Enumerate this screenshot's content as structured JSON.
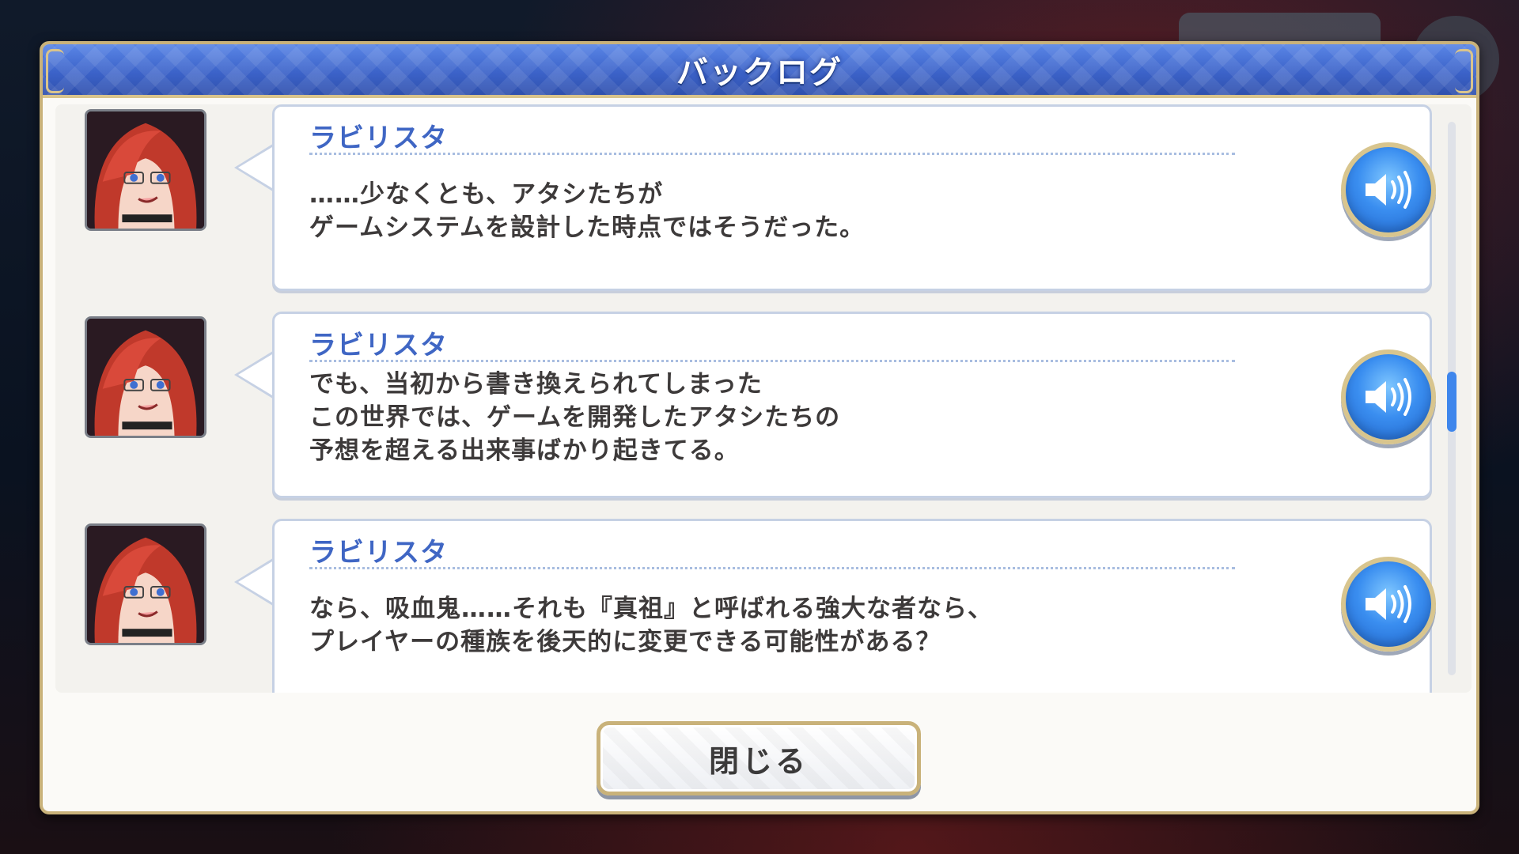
{
  "dialog": {
    "title": "バックログ",
    "close_label": "閉じる"
  },
  "entries": [
    {
      "speaker": "ラビリスタ",
      "lines": "……少なくとも、アタシたちが\nゲームシステムを設計した時点ではそうだった。",
      "voice_icon": "speaker-volume-icon"
    },
    {
      "speaker": "ラビリスタ",
      "lines": "でも、当初から書き換えられてしまった\nこの世界では、ゲームを開発したアタシたちの\n予想を超える出来事ばかり起きてる。",
      "voice_icon": "speaker-volume-icon"
    },
    {
      "speaker": "ラビリスタ",
      "lines": "なら、吸血鬼……それも『真祖』と呼ばれる強大な者なら、\nプレイヤーの種族を後天的に変更できる可能性がある？",
      "voice_icon": "speaker-volume-icon"
    }
  ],
  "colors": {
    "header_blue": "#3c63c9",
    "gold_border": "#c9b27a",
    "speaker_name": "#3f66c4",
    "scroll_thumb": "#3e86ec"
  }
}
